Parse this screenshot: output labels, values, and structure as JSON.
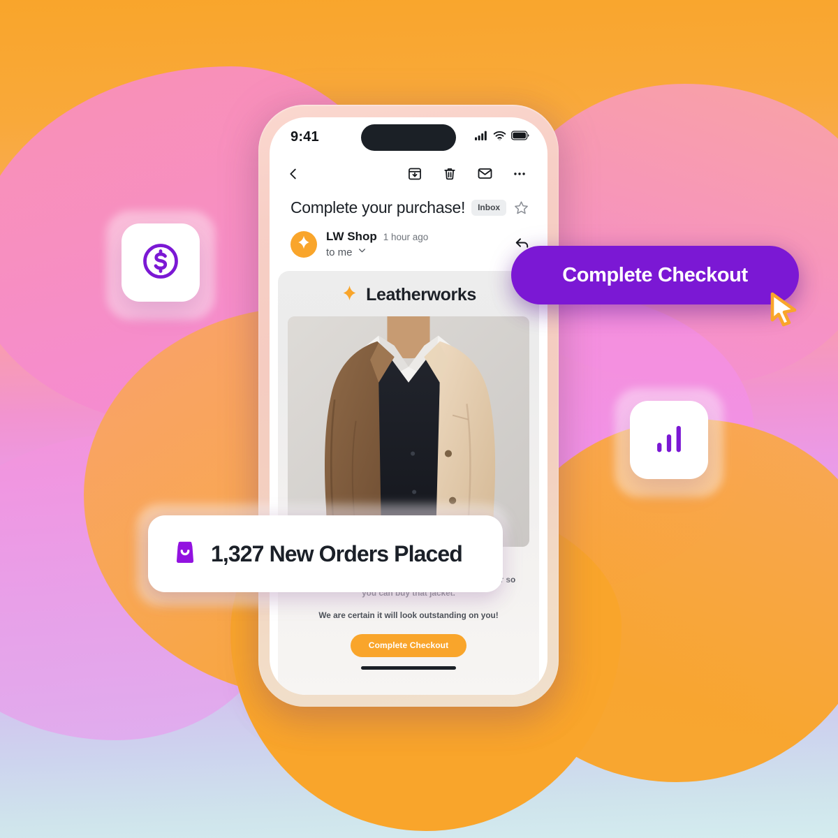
{
  "background": {
    "gradient_top": "#f9a52b",
    "gradient_bottom": "#d4ecef",
    "blob_pink": "#f48ad8",
    "blob_orange": "#f9a52b"
  },
  "colors": {
    "brand_purple": "#7b18d4",
    "brand_orange": "#f9a52b",
    "text_dark": "#1b2026"
  },
  "phone": {
    "status_bar": {
      "time": "9:41",
      "cellular_icon": "signal-bars-icon",
      "wifi_icon": "wifi-icon",
      "battery_icon": "battery-icon"
    },
    "mail_toolbar": {
      "back_icon": "chevron-left-icon",
      "archive_icon": "archive-icon",
      "delete_icon": "trash-icon",
      "mark_unread_icon": "envelope-icon",
      "more_icon": "more-options-icon"
    },
    "email": {
      "subject": "Complete your purchase!",
      "label_chip": "Inbox",
      "star_icon": "star-outline-icon",
      "sender_name": "LW Shop",
      "sender_avatar_icon": "sparkle-icon",
      "timestamp": "1 hour ago",
      "recipient": "to me",
      "recipient_expand_icon": "chevron-down-icon",
      "reply_icon": "reply-arrow-icon",
      "body": {
        "brand_name": "Leatherworks",
        "brand_icon": "sparkle-icon",
        "product_image_alt": "model wearing tan leather jacket over dark vest and white shirt",
        "paragraph_1": "Looks like you didn't get a chance to complete purchase. Here's a code for 25% off your next order so you can buy that jacket.",
        "paragraph_2": "We are certain it will look outstanding on you!",
        "cta_label": "Complete Checkout"
      }
    }
  },
  "overlays": {
    "purple_pill": {
      "label": "Complete Checkout",
      "cursor_icon": "mouse-pointer-icon"
    },
    "orders_card": {
      "icon": "shopping-bag-icon",
      "label": "1,327 New Orders Placed",
      "count": "1,327"
    },
    "dollar_card": {
      "icon": "dollar-circle-icon"
    },
    "chart_card": {
      "icon": "bar-chart-icon"
    }
  }
}
